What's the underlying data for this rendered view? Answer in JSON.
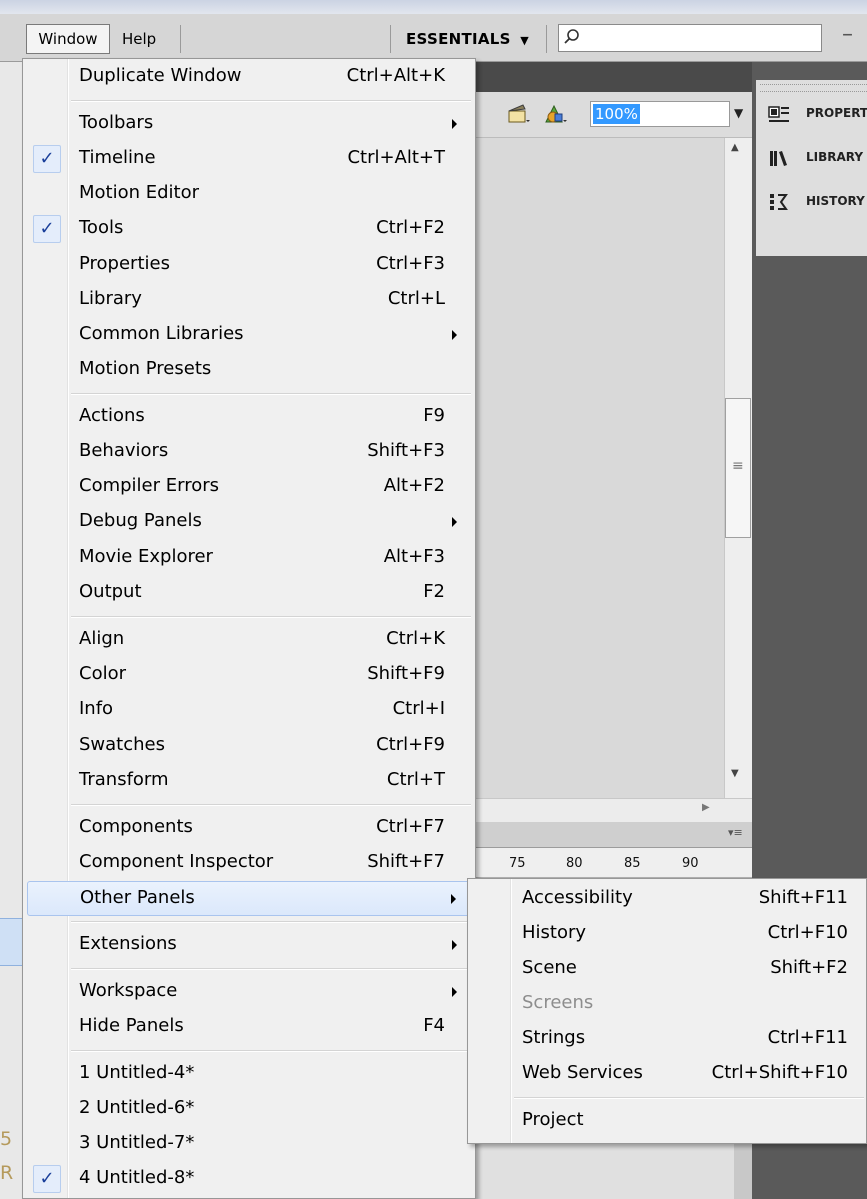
{
  "menubar": {
    "window": "Window",
    "help": "Help",
    "workspace": "ESSENTIALS",
    "workspace_arrow": "▼",
    "minimize": "–"
  },
  "toolbar": {
    "zoom": "100%"
  },
  "ruler": [
    "75",
    "80",
    "85",
    "90"
  ],
  "dock": {
    "items": [
      {
        "label": "PROPERT",
        "icon": "properties-icon"
      },
      {
        "label": "LIBRARY",
        "icon": "library-icon"
      },
      {
        "label": "HISTORY",
        "icon": "history-icon"
      }
    ]
  },
  "background_text": [
    "5",
    "R"
  ],
  "window_menu": {
    "items": [
      {
        "label": "Duplicate Window",
        "shortcut": "Ctrl+Alt+K"
      },
      {
        "label": "Toolbars",
        "submenu": true
      },
      {
        "label": "Timeline",
        "shortcut": "Ctrl+Alt+T",
        "checked": true
      },
      {
        "label": "Motion Editor"
      },
      {
        "label": "Tools",
        "shortcut": "Ctrl+F2",
        "checked": true
      },
      {
        "label": "Properties",
        "shortcut": "Ctrl+F3"
      },
      {
        "label": "Library",
        "shortcut": "Ctrl+L"
      },
      {
        "label": "Common Libraries",
        "submenu": true
      },
      {
        "label": "Motion Presets"
      },
      {
        "label": "Actions",
        "shortcut": "F9"
      },
      {
        "label": "Behaviors",
        "shortcut": "Shift+F3"
      },
      {
        "label": "Compiler Errors",
        "shortcut": "Alt+F2"
      },
      {
        "label": "Debug Panels",
        "submenu": true
      },
      {
        "label": "Movie Explorer",
        "shortcut": "Alt+F3"
      },
      {
        "label": "Output",
        "shortcut": "F2"
      },
      {
        "label": "Align",
        "shortcut": "Ctrl+K"
      },
      {
        "label": "Color",
        "shortcut": "Shift+F9"
      },
      {
        "label": "Info",
        "shortcut": "Ctrl+I"
      },
      {
        "label": "Swatches",
        "shortcut": "Ctrl+F9"
      },
      {
        "label": "Transform",
        "shortcut": "Ctrl+T"
      },
      {
        "label": "Components",
        "shortcut": "Ctrl+F7"
      },
      {
        "label": "Component Inspector",
        "shortcut": "Shift+F7"
      },
      {
        "label": "Other Panels",
        "submenu": true,
        "highlighted": true
      },
      {
        "label": "Extensions",
        "submenu": true
      },
      {
        "label": "Workspace",
        "submenu": true
      },
      {
        "label": "Hide Panels",
        "shortcut": "F4"
      },
      {
        "label": "1 Untitled-4*"
      },
      {
        "label": "2 Untitled-6*"
      },
      {
        "label": "3 Untitled-7*"
      },
      {
        "label": "4 Untitled-8*",
        "checked": true
      }
    ]
  },
  "other_panels_submenu": {
    "items": [
      {
        "label": "Accessibility",
        "shortcut": "Shift+F11"
      },
      {
        "label": "History",
        "shortcut": "Ctrl+F10"
      },
      {
        "label": "Scene",
        "shortcut": "Shift+F2"
      },
      {
        "label": "Screens",
        "disabled": true
      },
      {
        "label": "Strings",
        "shortcut": "Ctrl+F11"
      },
      {
        "label": "Web Services",
        "shortcut": "Ctrl+Shift+F10"
      },
      {
        "label": "Project"
      }
    ]
  },
  "check_glyph": "✓"
}
